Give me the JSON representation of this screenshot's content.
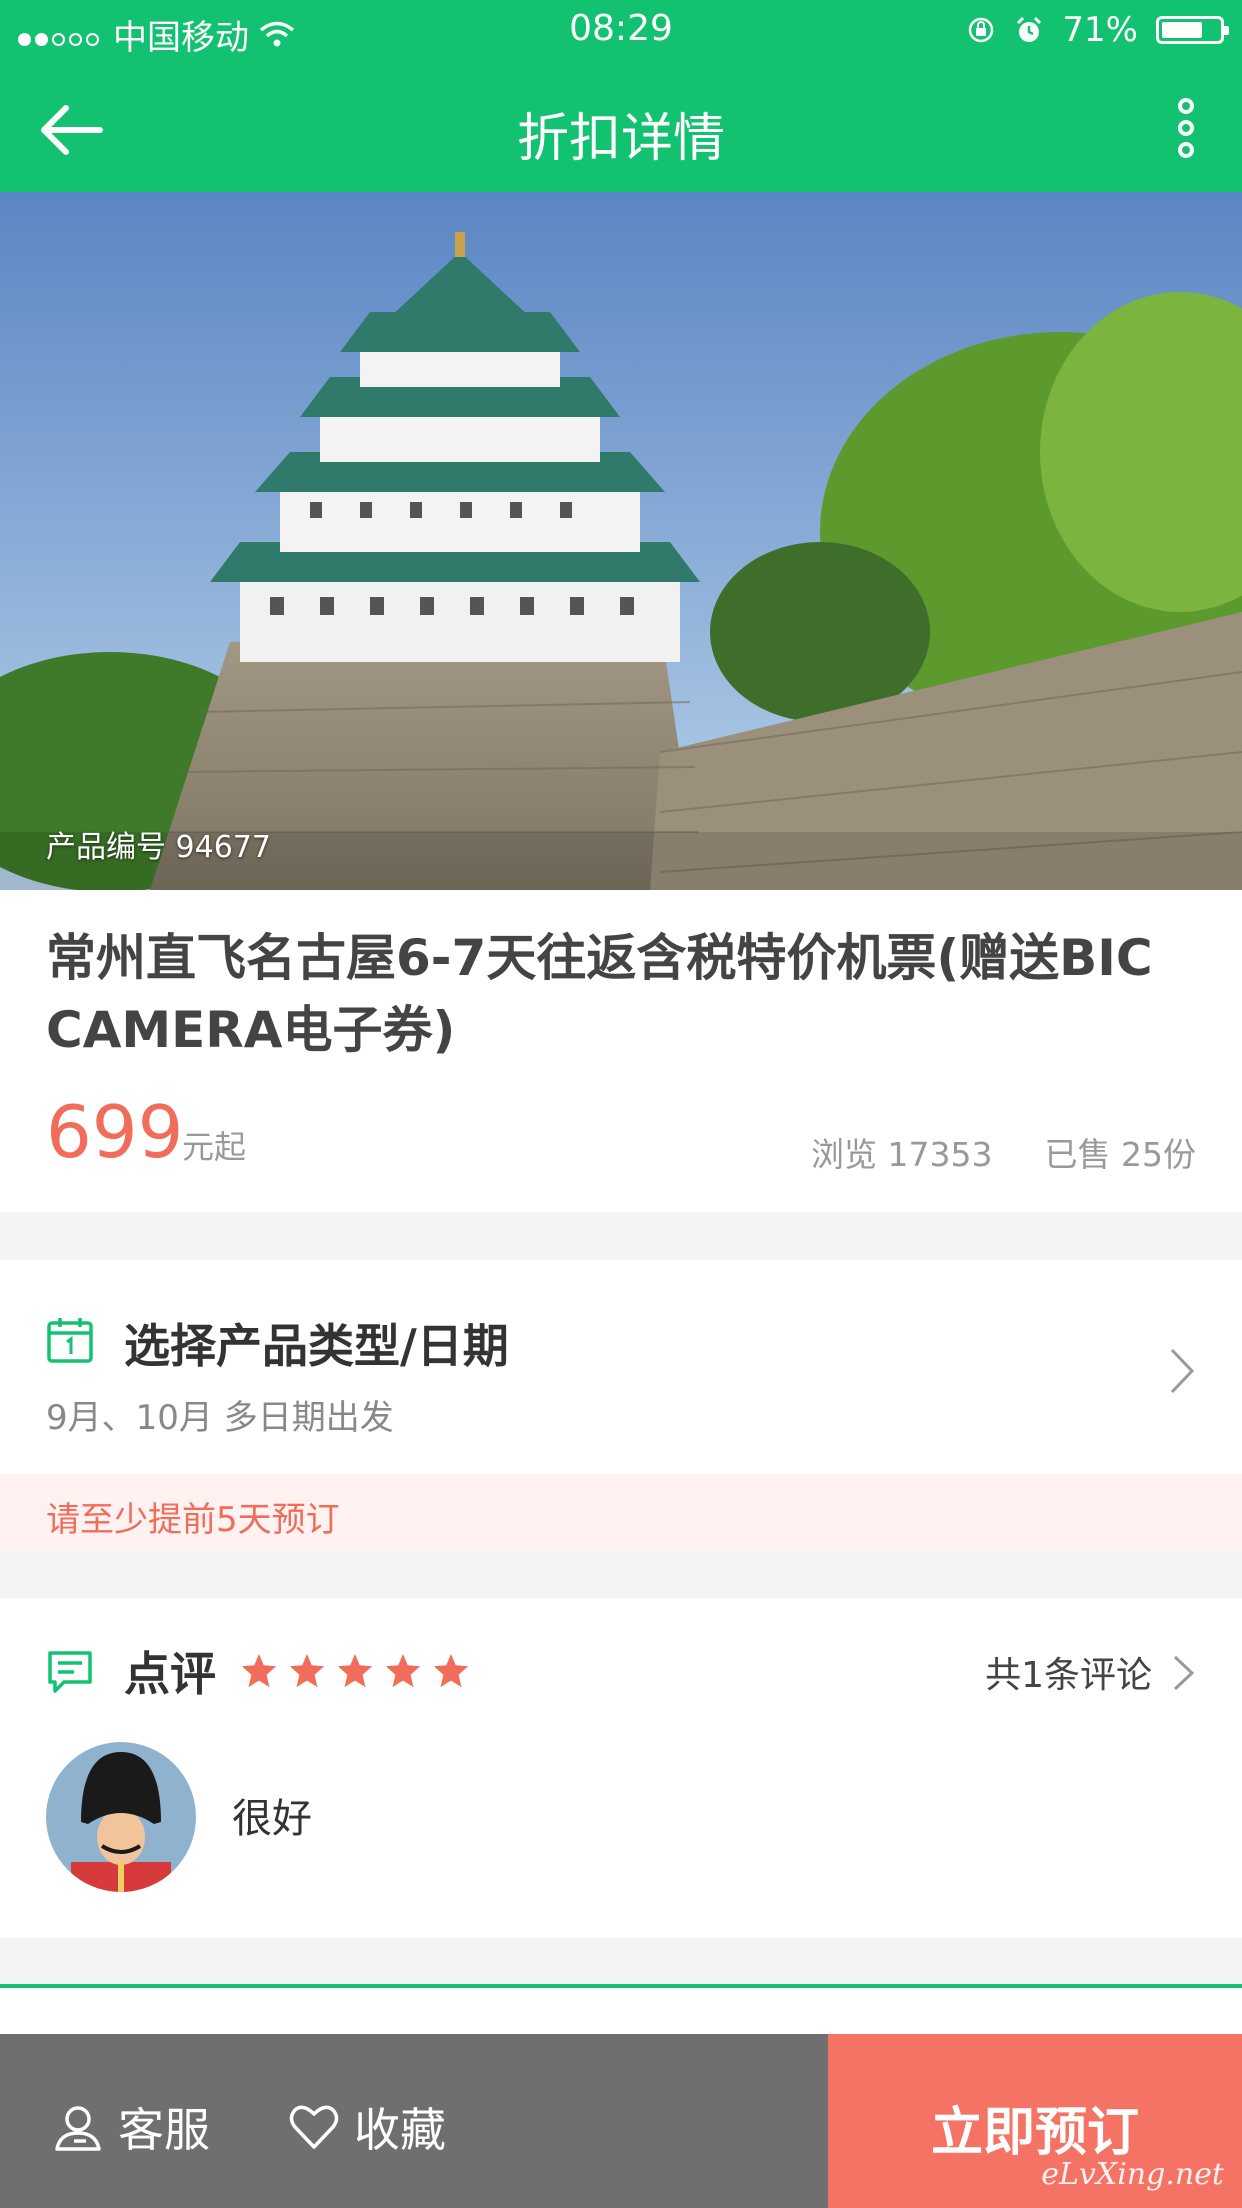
{
  "status_bar": {
    "carrier": "中国移动",
    "time": "08:29",
    "battery": "71%",
    "battery_level": 0.71
  },
  "nav": {
    "title": "折扣详情",
    "back_icon": "arrow-left-icon",
    "more_icon": "vertical-dots-icon"
  },
  "hero": {
    "product_code": "产品编号 94677"
  },
  "product": {
    "title": "常州直飞名古屋6-7天往返含税特价机票(赠送BIC CAMERA电子券)",
    "price": "699",
    "price_unit": "元起",
    "views": "浏览 17353",
    "sold": "已售 25份"
  },
  "select_section": {
    "label": "选择产品类型/日期",
    "dates": "9月、10月 多日期出发",
    "icon": "calendar-icon"
  },
  "notice": {
    "text": "请至少提前5天预订"
  },
  "review": {
    "label": "点评",
    "rating": 5,
    "count_text": "共1条评论",
    "comment": "很好",
    "icon": "comment-bubble-icon"
  },
  "bottom_bar": {
    "customer_service": "客服",
    "favorite": "收藏",
    "book_now": "立即预订",
    "watermark": "eLvXing.net"
  },
  "colors": {
    "brand_green": "#12c271",
    "price_red": "#f26c5b",
    "book_button": "#f57365",
    "bottom_gray": "#6f6f6f"
  }
}
